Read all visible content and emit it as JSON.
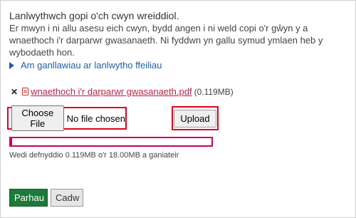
{
  "upload": {
    "title": "Lanlwythwch gopi o'ch cwyn wreiddiol.",
    "description": "Er mwyn i ni allu asesu eich cwyn, bydd angen i ni weld copi o'r gŵyn y a wnaethoch i'r darparwr gwasanaeth. Ni fyddwn yn gallu symud ymlaen heb y wybodaeth hon.",
    "guidance_link": "Am ganllawiau ar lanlwytho ffeiliau",
    "file": {
      "name": "wnaethoch i'r darparwr gwasanaeth.pdf",
      "size": "(0.119MB)"
    },
    "choose_file_label": "Choose File",
    "no_file_text": "No file chosen",
    "upload_label": "Upload",
    "usage_text": "Wedi defnyddio 0.119MB o'r 18.00MB a ganiateir",
    "usage_fraction": 0.0066
  },
  "actions": {
    "continue_label": "Parhau",
    "save_label": "Cadw"
  },
  "colors": {
    "link": "#1d5fa8",
    "file_link": "#b0264a",
    "highlight_border": "#e0001b",
    "progress": "#c8005a",
    "continue_bg": "#1d7a3a"
  }
}
